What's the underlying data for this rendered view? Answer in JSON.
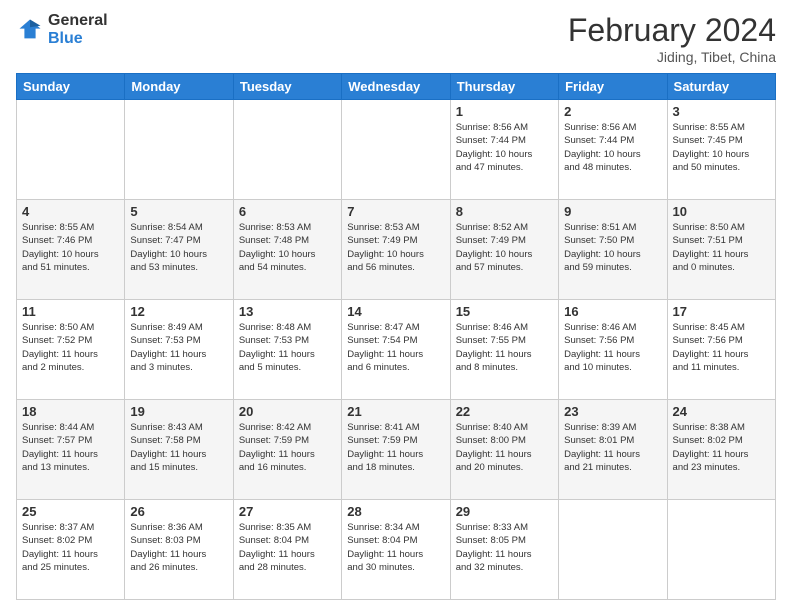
{
  "logo": {
    "line1": "General",
    "line2": "Blue"
  },
  "title": "February 2024",
  "location": "Jiding, Tibet, China",
  "days": [
    "Sunday",
    "Monday",
    "Tuesday",
    "Wednesday",
    "Thursday",
    "Friday",
    "Saturday"
  ],
  "weeks": [
    [
      {
        "num": "",
        "info": ""
      },
      {
        "num": "",
        "info": ""
      },
      {
        "num": "",
        "info": ""
      },
      {
        "num": "",
        "info": ""
      },
      {
        "num": "1",
        "info": "Sunrise: 8:56 AM\nSunset: 7:44 PM\nDaylight: 10 hours\nand 47 minutes."
      },
      {
        "num": "2",
        "info": "Sunrise: 8:56 AM\nSunset: 7:44 PM\nDaylight: 10 hours\nand 48 minutes."
      },
      {
        "num": "3",
        "info": "Sunrise: 8:55 AM\nSunset: 7:45 PM\nDaylight: 10 hours\nand 50 minutes."
      }
    ],
    [
      {
        "num": "4",
        "info": "Sunrise: 8:55 AM\nSunset: 7:46 PM\nDaylight: 10 hours\nand 51 minutes."
      },
      {
        "num": "5",
        "info": "Sunrise: 8:54 AM\nSunset: 7:47 PM\nDaylight: 10 hours\nand 53 minutes."
      },
      {
        "num": "6",
        "info": "Sunrise: 8:53 AM\nSunset: 7:48 PM\nDaylight: 10 hours\nand 54 minutes."
      },
      {
        "num": "7",
        "info": "Sunrise: 8:53 AM\nSunset: 7:49 PM\nDaylight: 10 hours\nand 56 minutes."
      },
      {
        "num": "8",
        "info": "Sunrise: 8:52 AM\nSunset: 7:49 PM\nDaylight: 10 hours\nand 57 minutes."
      },
      {
        "num": "9",
        "info": "Sunrise: 8:51 AM\nSunset: 7:50 PM\nDaylight: 10 hours\nand 59 minutes."
      },
      {
        "num": "10",
        "info": "Sunrise: 8:50 AM\nSunset: 7:51 PM\nDaylight: 11 hours\nand 0 minutes."
      }
    ],
    [
      {
        "num": "11",
        "info": "Sunrise: 8:50 AM\nSunset: 7:52 PM\nDaylight: 11 hours\nand 2 minutes."
      },
      {
        "num": "12",
        "info": "Sunrise: 8:49 AM\nSunset: 7:53 PM\nDaylight: 11 hours\nand 3 minutes."
      },
      {
        "num": "13",
        "info": "Sunrise: 8:48 AM\nSunset: 7:53 PM\nDaylight: 11 hours\nand 5 minutes."
      },
      {
        "num": "14",
        "info": "Sunrise: 8:47 AM\nSunset: 7:54 PM\nDaylight: 11 hours\nand 6 minutes."
      },
      {
        "num": "15",
        "info": "Sunrise: 8:46 AM\nSunset: 7:55 PM\nDaylight: 11 hours\nand 8 minutes."
      },
      {
        "num": "16",
        "info": "Sunrise: 8:46 AM\nSunset: 7:56 PM\nDaylight: 11 hours\nand 10 minutes."
      },
      {
        "num": "17",
        "info": "Sunrise: 8:45 AM\nSunset: 7:56 PM\nDaylight: 11 hours\nand 11 minutes."
      }
    ],
    [
      {
        "num": "18",
        "info": "Sunrise: 8:44 AM\nSunset: 7:57 PM\nDaylight: 11 hours\nand 13 minutes."
      },
      {
        "num": "19",
        "info": "Sunrise: 8:43 AM\nSunset: 7:58 PM\nDaylight: 11 hours\nand 15 minutes."
      },
      {
        "num": "20",
        "info": "Sunrise: 8:42 AM\nSunset: 7:59 PM\nDaylight: 11 hours\nand 16 minutes."
      },
      {
        "num": "21",
        "info": "Sunrise: 8:41 AM\nSunset: 7:59 PM\nDaylight: 11 hours\nand 18 minutes."
      },
      {
        "num": "22",
        "info": "Sunrise: 8:40 AM\nSunset: 8:00 PM\nDaylight: 11 hours\nand 20 minutes."
      },
      {
        "num": "23",
        "info": "Sunrise: 8:39 AM\nSunset: 8:01 PM\nDaylight: 11 hours\nand 21 minutes."
      },
      {
        "num": "24",
        "info": "Sunrise: 8:38 AM\nSunset: 8:02 PM\nDaylight: 11 hours\nand 23 minutes."
      }
    ],
    [
      {
        "num": "25",
        "info": "Sunrise: 8:37 AM\nSunset: 8:02 PM\nDaylight: 11 hours\nand 25 minutes."
      },
      {
        "num": "26",
        "info": "Sunrise: 8:36 AM\nSunset: 8:03 PM\nDaylight: 11 hours\nand 26 minutes."
      },
      {
        "num": "27",
        "info": "Sunrise: 8:35 AM\nSunset: 8:04 PM\nDaylight: 11 hours\nand 28 minutes."
      },
      {
        "num": "28",
        "info": "Sunrise: 8:34 AM\nSunset: 8:04 PM\nDaylight: 11 hours\nand 30 minutes."
      },
      {
        "num": "29",
        "info": "Sunrise: 8:33 AM\nSunset: 8:05 PM\nDaylight: 11 hours\nand 32 minutes."
      },
      {
        "num": "",
        "info": ""
      },
      {
        "num": "",
        "info": ""
      }
    ]
  ]
}
